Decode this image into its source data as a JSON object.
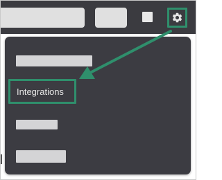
{
  "menu": {
    "items": [
      {
        "label": "",
        "placeholder": true
      },
      {
        "label": "Integrations",
        "placeholder": false,
        "highlighted": true
      },
      {
        "label": "",
        "placeholder": true
      },
      {
        "label": "",
        "placeholder": true
      }
    ]
  },
  "colors": {
    "topbar": "#3b3b40",
    "menu_background": "#3c3c42",
    "highlight": "#2f8f6c",
    "placeholder": "#d4d4d6"
  },
  "icons": {
    "settings": "gear-icon"
  }
}
